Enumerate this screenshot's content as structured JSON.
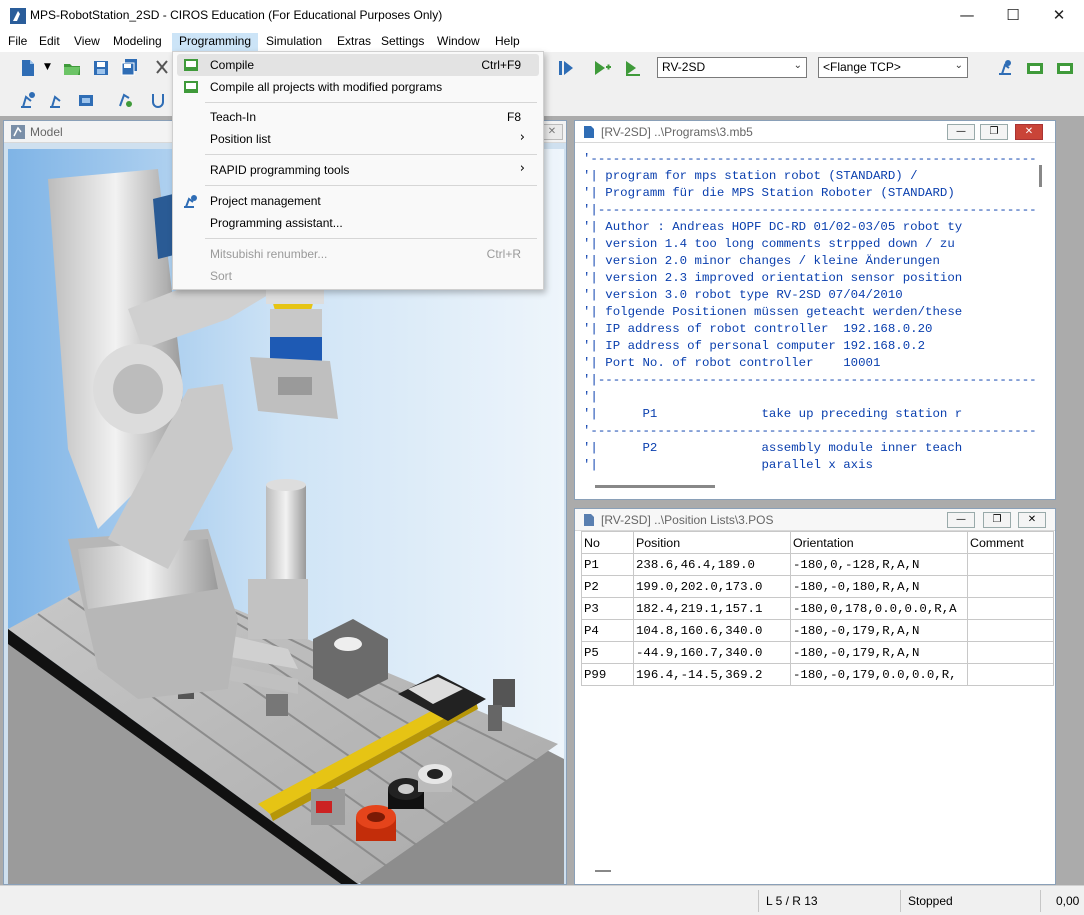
{
  "window": {
    "title": "MPS-RobotStation_2SD - CIROS Education (For Educational Purposes Only)",
    "minimize": "—",
    "maximize": "☐",
    "close": "✕"
  },
  "menubar": [
    "File",
    "Edit",
    "View",
    "Modeling",
    "Programming",
    "Simulation",
    "Extras",
    "Settings",
    "Window",
    "Help"
  ],
  "toolbar": {
    "robot_combo": "RV-2SD",
    "tcp_combo": "<Flange TCP>"
  },
  "programming_menu": {
    "items": [
      {
        "label": "Compile",
        "shortcut": "Ctrl+F9",
        "icon": "compile-icon"
      },
      {
        "label": "Compile all projects with modified porgrams",
        "icon": "compile-all-icon"
      },
      {
        "label": "Teach-In",
        "shortcut": "F8"
      },
      {
        "label": "Position list",
        "submenu": "›"
      },
      {
        "label": "RAPID programming tools",
        "submenu": "›"
      },
      {
        "label": "Project management",
        "icon": "project-management-icon"
      },
      {
        "label": "Programming assistant..."
      },
      {
        "label": "Mitsubishi renumber...",
        "shortcut": "Ctrl+R"
      },
      {
        "label": "Sort"
      }
    ]
  },
  "model_window": {
    "title": "Model"
  },
  "program_window": {
    "title": "[RV-2SD] ..\\Programs\\3.mb5",
    "lines": [
      "'------------------------------------------------------------",
      "'| program for mps station robot (STANDARD) /",
      "'| Programm für die MPS Station Roboter (STANDARD)",
      "'|-----------------------------------------------------------",
      "'| Author : Andreas HOPF DC-RD 01/02-03/05 robot ty",
      "'| version 1.4 too long comments strpped down / zu",
      "'| version 2.0 minor changes / kleine Änderungen",
      "'| version 2.3 improved orientation sensor position",
      "'| version 3.0 robot type RV-2SD 07/04/2010",
      "'| folgende Positionen müssen geteacht werden/these",
      "'| IP address of robot controller  192.168.0.20",
      "'| IP address of personal computer 192.168.0.2",
      "'| Port No. of robot controller    10001",
      "'|-----------------------------------------------------------",
      "'|",
      "'|      P1              take up preceding station r",
      "'------------------------------------------------------------",
      "'|      P2              assembly module inner teach",
      "'|                      parallel x axis"
    ]
  },
  "position_window": {
    "title": "[RV-2SD] ..\\Position Lists\\3.POS",
    "columns": [
      "No",
      "Position",
      "Orientation",
      "Comment"
    ],
    "rows": [
      [
        "P1",
        "238.6,46.4,189.0",
        "-180,0,-128,R,A,N",
        ""
      ],
      [
        "P2",
        "199.0,202.0,173.0",
        "-180,-0,180,R,A,N",
        ""
      ],
      [
        "P3",
        "182.4,219.1,157.1",
        "-180,0,178,0.0,0.0,R,A",
        ""
      ],
      [
        "P4",
        "104.8,160.6,340.0",
        "-180,-0,179,R,A,N",
        ""
      ],
      [
        "P5",
        "-44.9,160.7,340.0",
        "-180,-0,179,R,A,N",
        ""
      ],
      [
        "P99",
        "196.4,-14.5,369.2",
        "-180,-0,179,0.0,0.0,R,",
        ""
      ]
    ]
  },
  "statusbar": {
    "cursor": "L 5 / R 13",
    "state": "Stopped",
    "value": "0,00"
  }
}
